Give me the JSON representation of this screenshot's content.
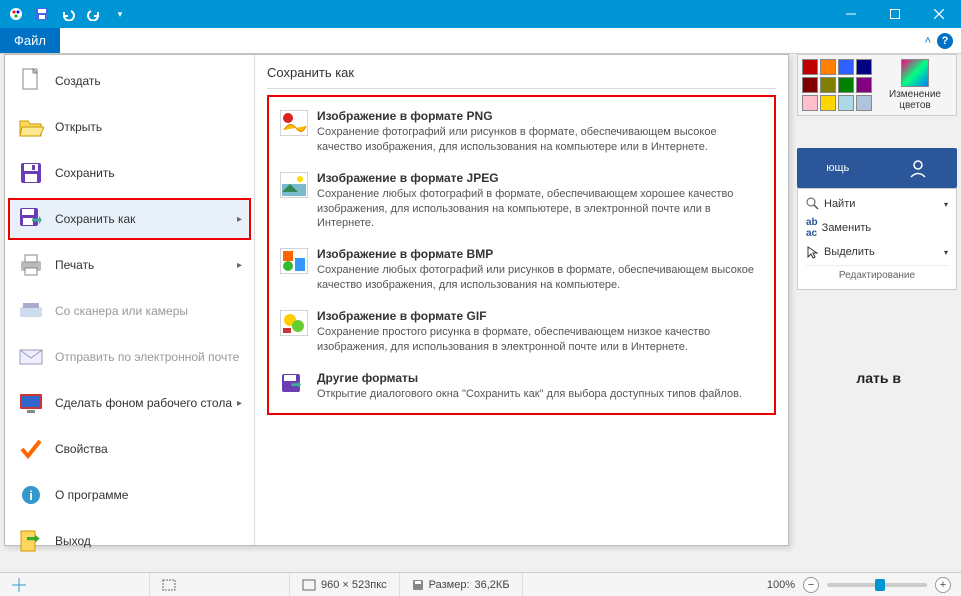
{
  "titlebar": {
    "app": "Paint"
  },
  "ribbon": {
    "file_tab": "Файл",
    "collapse": "^"
  },
  "menu": {
    "items": [
      {
        "label": "Создать",
        "icon": "new",
        "submenu": false
      },
      {
        "label": "Открыть",
        "icon": "open",
        "submenu": false
      },
      {
        "label": "Сохранить",
        "icon": "save",
        "submenu": false
      },
      {
        "label": "Сохранить как",
        "icon": "saveas",
        "submenu": true,
        "active": true
      },
      {
        "label": "Печать",
        "icon": "print",
        "submenu": true
      },
      {
        "label": "Со сканера или камеры",
        "icon": "scanner",
        "submenu": false,
        "disabled": true
      },
      {
        "label": "Отправить по электронной почте",
        "icon": "mail",
        "submenu": false,
        "disabled": true
      },
      {
        "label": "Сделать фоном рабочего стола",
        "icon": "desktop",
        "submenu": true
      },
      {
        "label": "Свойства",
        "icon": "props",
        "submenu": false
      },
      {
        "label": "О программе",
        "icon": "about",
        "submenu": false
      },
      {
        "label": "Выход",
        "icon": "exit",
        "submenu": false
      }
    ]
  },
  "submenu": {
    "header": "Сохранить как",
    "formats": [
      {
        "title": "Изображение в формате PNG",
        "desc": "Сохранение фотографий или рисунков в формате, обеспечивающем высокое качество изображения, для использования на компьютере или в Интернете.",
        "icon": "png"
      },
      {
        "title": "Изображение в формате JPEG",
        "desc": "Сохранение любых фотографий в формате, обеспечивающем хорошее качество изображения, для использования на компьютере, в электронной почте или в Интернете.",
        "icon": "jpeg"
      },
      {
        "title": "Изображение в формате BMP",
        "desc": "Сохранение любых фотографий или рисунков в формате, обеспечивающем высокое качество изображения, для использования на компьютере.",
        "icon": "bmp"
      },
      {
        "title": "Изображение в формате GIF",
        "desc": "Сохранение простого рисунка в формате, обеспечивающем низкое качество изображения, для использования в электронной почте или в Интернете.",
        "icon": "gif"
      },
      {
        "title": "Другие форматы",
        "desc": "Открытие диалогового окна \"Сохранить как\" для выбора доступных типов файлов.",
        "icon": "other"
      }
    ]
  },
  "palette": {
    "edit_label": "Изменение цветов",
    "colors": [
      "#c00000",
      "#ff8000",
      "#0000ff",
      "#000080",
      "#800000",
      "#808000",
      "#008000",
      "#800080",
      "#ffc0cb",
      "#ffd700",
      "#add8e6",
      "#b0c4de"
    ]
  },
  "word": {
    "help": "ющь",
    "find": "Найти",
    "replace": "Заменить",
    "select": "Выделить",
    "group": "Редактирование",
    "canvas_hint": "лать в"
  },
  "status": {
    "pos_label": "+",
    "dpi": "",
    "dim_icon": "⬚",
    "dim": "960 × 523пкс",
    "size_icon": "🖫",
    "size_label": "Размер:",
    "size": "36,2КБ",
    "zoom": "100%"
  }
}
